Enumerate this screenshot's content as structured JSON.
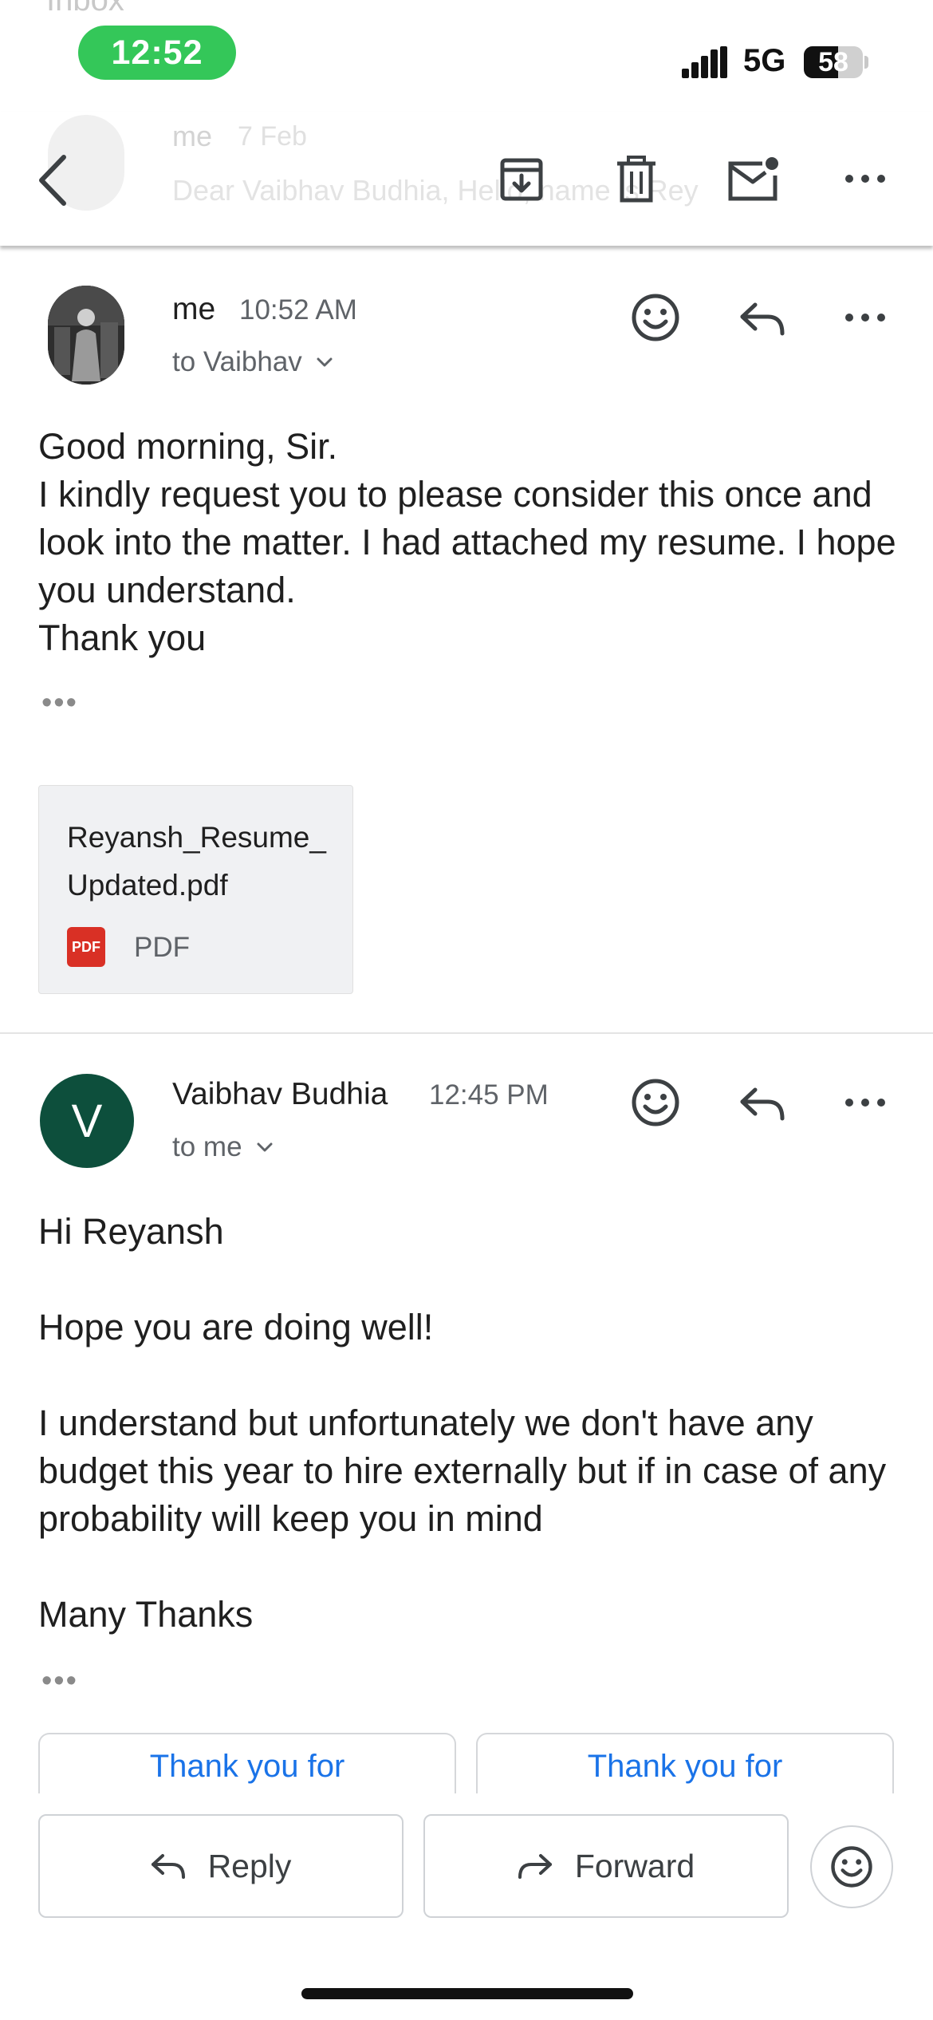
{
  "status_bar": {
    "time": "12:52",
    "network": "5G",
    "battery_level": "58",
    "battery_fraction": 0.58,
    "ghost_folder_label": "Inbox"
  },
  "toolbar": {
    "back_icon": "chevron-left-icon",
    "archive_icon": "archive-icon",
    "delete_icon": "trash-icon",
    "mark_unread_icon": "mail-unread-icon",
    "more_icon": "more-horizontal-icon",
    "ghost_sender": "me",
    "ghost_date": "7 Feb",
    "ghost_preview": "Dear Vaibhav Budhia, Hello, name is Rey"
  },
  "messages": [
    {
      "sender": "me",
      "time": "10:52 AM",
      "to": "to Vaibhav",
      "avatar_type": "photo",
      "body": [
        "Good morning, Sir.",
        "I kindly request you to please consider this once and look into the matter. I had attached my resume. I hope you understand.",
        "Thank you"
      ],
      "trimmed_indicator": "•••",
      "attachment": {
        "filename": "Reyansh_Resume_Updated.pdf",
        "type_label": "PDF",
        "badge": "PDF"
      }
    },
    {
      "sender": "Vaibhav Budhia",
      "time": "12:45 PM",
      "to": "to me",
      "avatar_letter": "V",
      "avatar_color": "#0d4f3c",
      "body": [
        "Hi Reyansh",
        "Hope you are doing well!",
        "I understand but unfortunately we don't have any budget this year to hire externally but if in case of any probability will keep you in mind",
        "Many Thanks"
      ],
      "trimmed_indicator": "•••"
    }
  ],
  "smart_replies": [
    "Thank you for",
    "Thank you for"
  ],
  "actions": {
    "reply_label": "Reply",
    "forward_label": "Forward"
  },
  "colors": {
    "accent_blue": "#1a73e8",
    "status_green": "#34c759",
    "pdf_red": "#d93025",
    "text_primary": "#1f1f1f",
    "text_secondary": "#5f6368"
  }
}
